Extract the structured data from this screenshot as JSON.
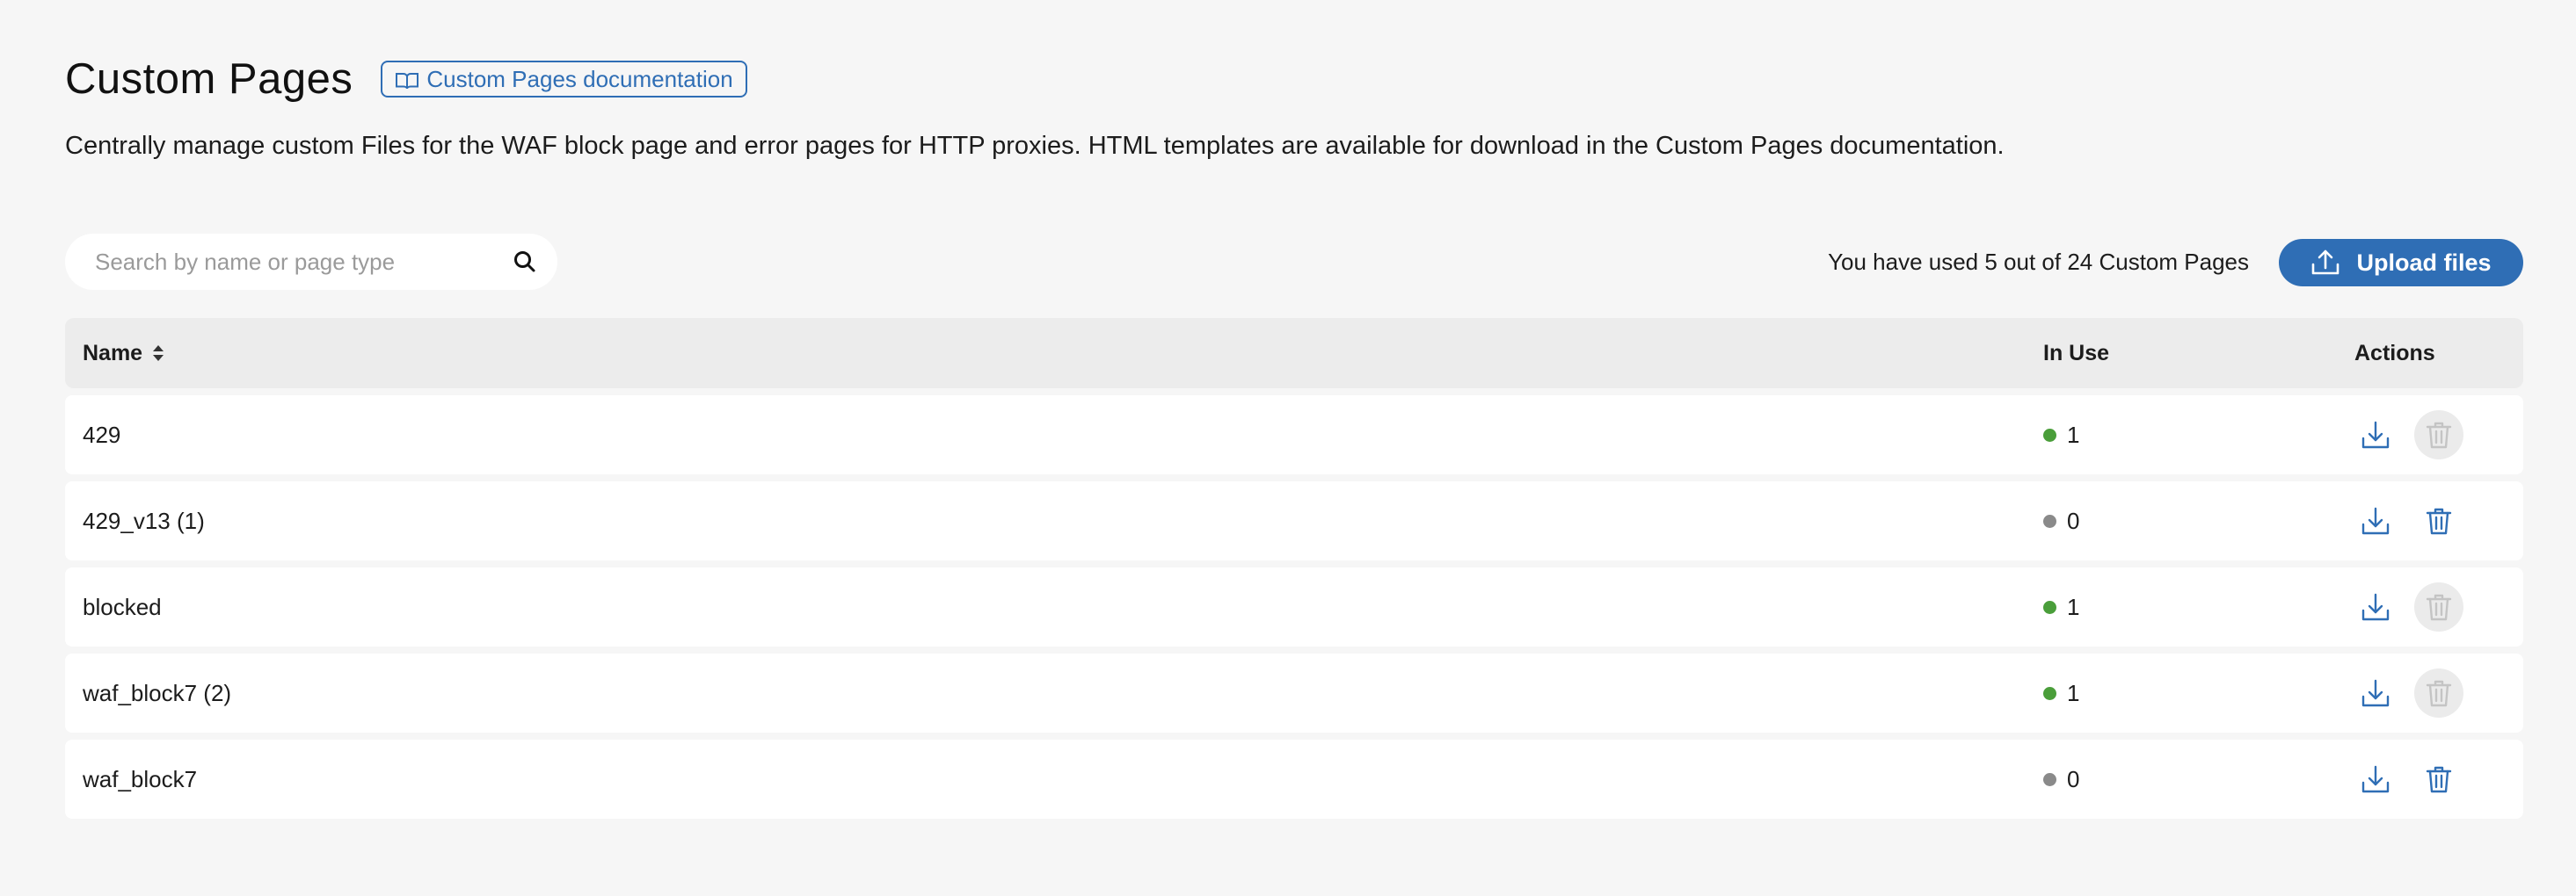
{
  "header": {
    "title": "Custom Pages",
    "doc_link_label": "Custom Pages documentation",
    "description": "Centrally manage custom Files for the WAF block page and error pages for HTTP proxies. HTML templates are available for download in the Custom Pages documentation."
  },
  "toolbar": {
    "search_placeholder": "Search by name or page type",
    "search_value": "",
    "usage_text": "You have used 5 out of 24 Custom Pages",
    "upload_label": "Upload files"
  },
  "table": {
    "columns": {
      "name": "Name",
      "in_use": "In Use",
      "actions": "Actions"
    },
    "rows": [
      {
        "name": "429",
        "in_use": "1",
        "active": true,
        "delete_enabled": false
      },
      {
        "name": "429_v13 (1)",
        "in_use": "0",
        "active": false,
        "delete_enabled": true
      },
      {
        "name": "blocked",
        "in_use": "1",
        "active": true,
        "delete_enabled": false
      },
      {
        "name": "waf_block7 (2)",
        "in_use": "1",
        "active": true,
        "delete_enabled": false
      },
      {
        "name": "waf_block7",
        "in_use": "0",
        "active": false,
        "delete_enabled": true
      }
    ]
  },
  "colors": {
    "accent": "#2f6eb5",
    "active_dot": "#4a9e3a",
    "inactive_dot": "#8a8a8a",
    "disabled_icon": "#c4c4c4"
  },
  "icons": {
    "doc_link": "book-icon",
    "search": "search-icon",
    "upload": "upload-icon",
    "sort": "sort-icon",
    "download": "download-icon",
    "delete": "trash-icon"
  }
}
